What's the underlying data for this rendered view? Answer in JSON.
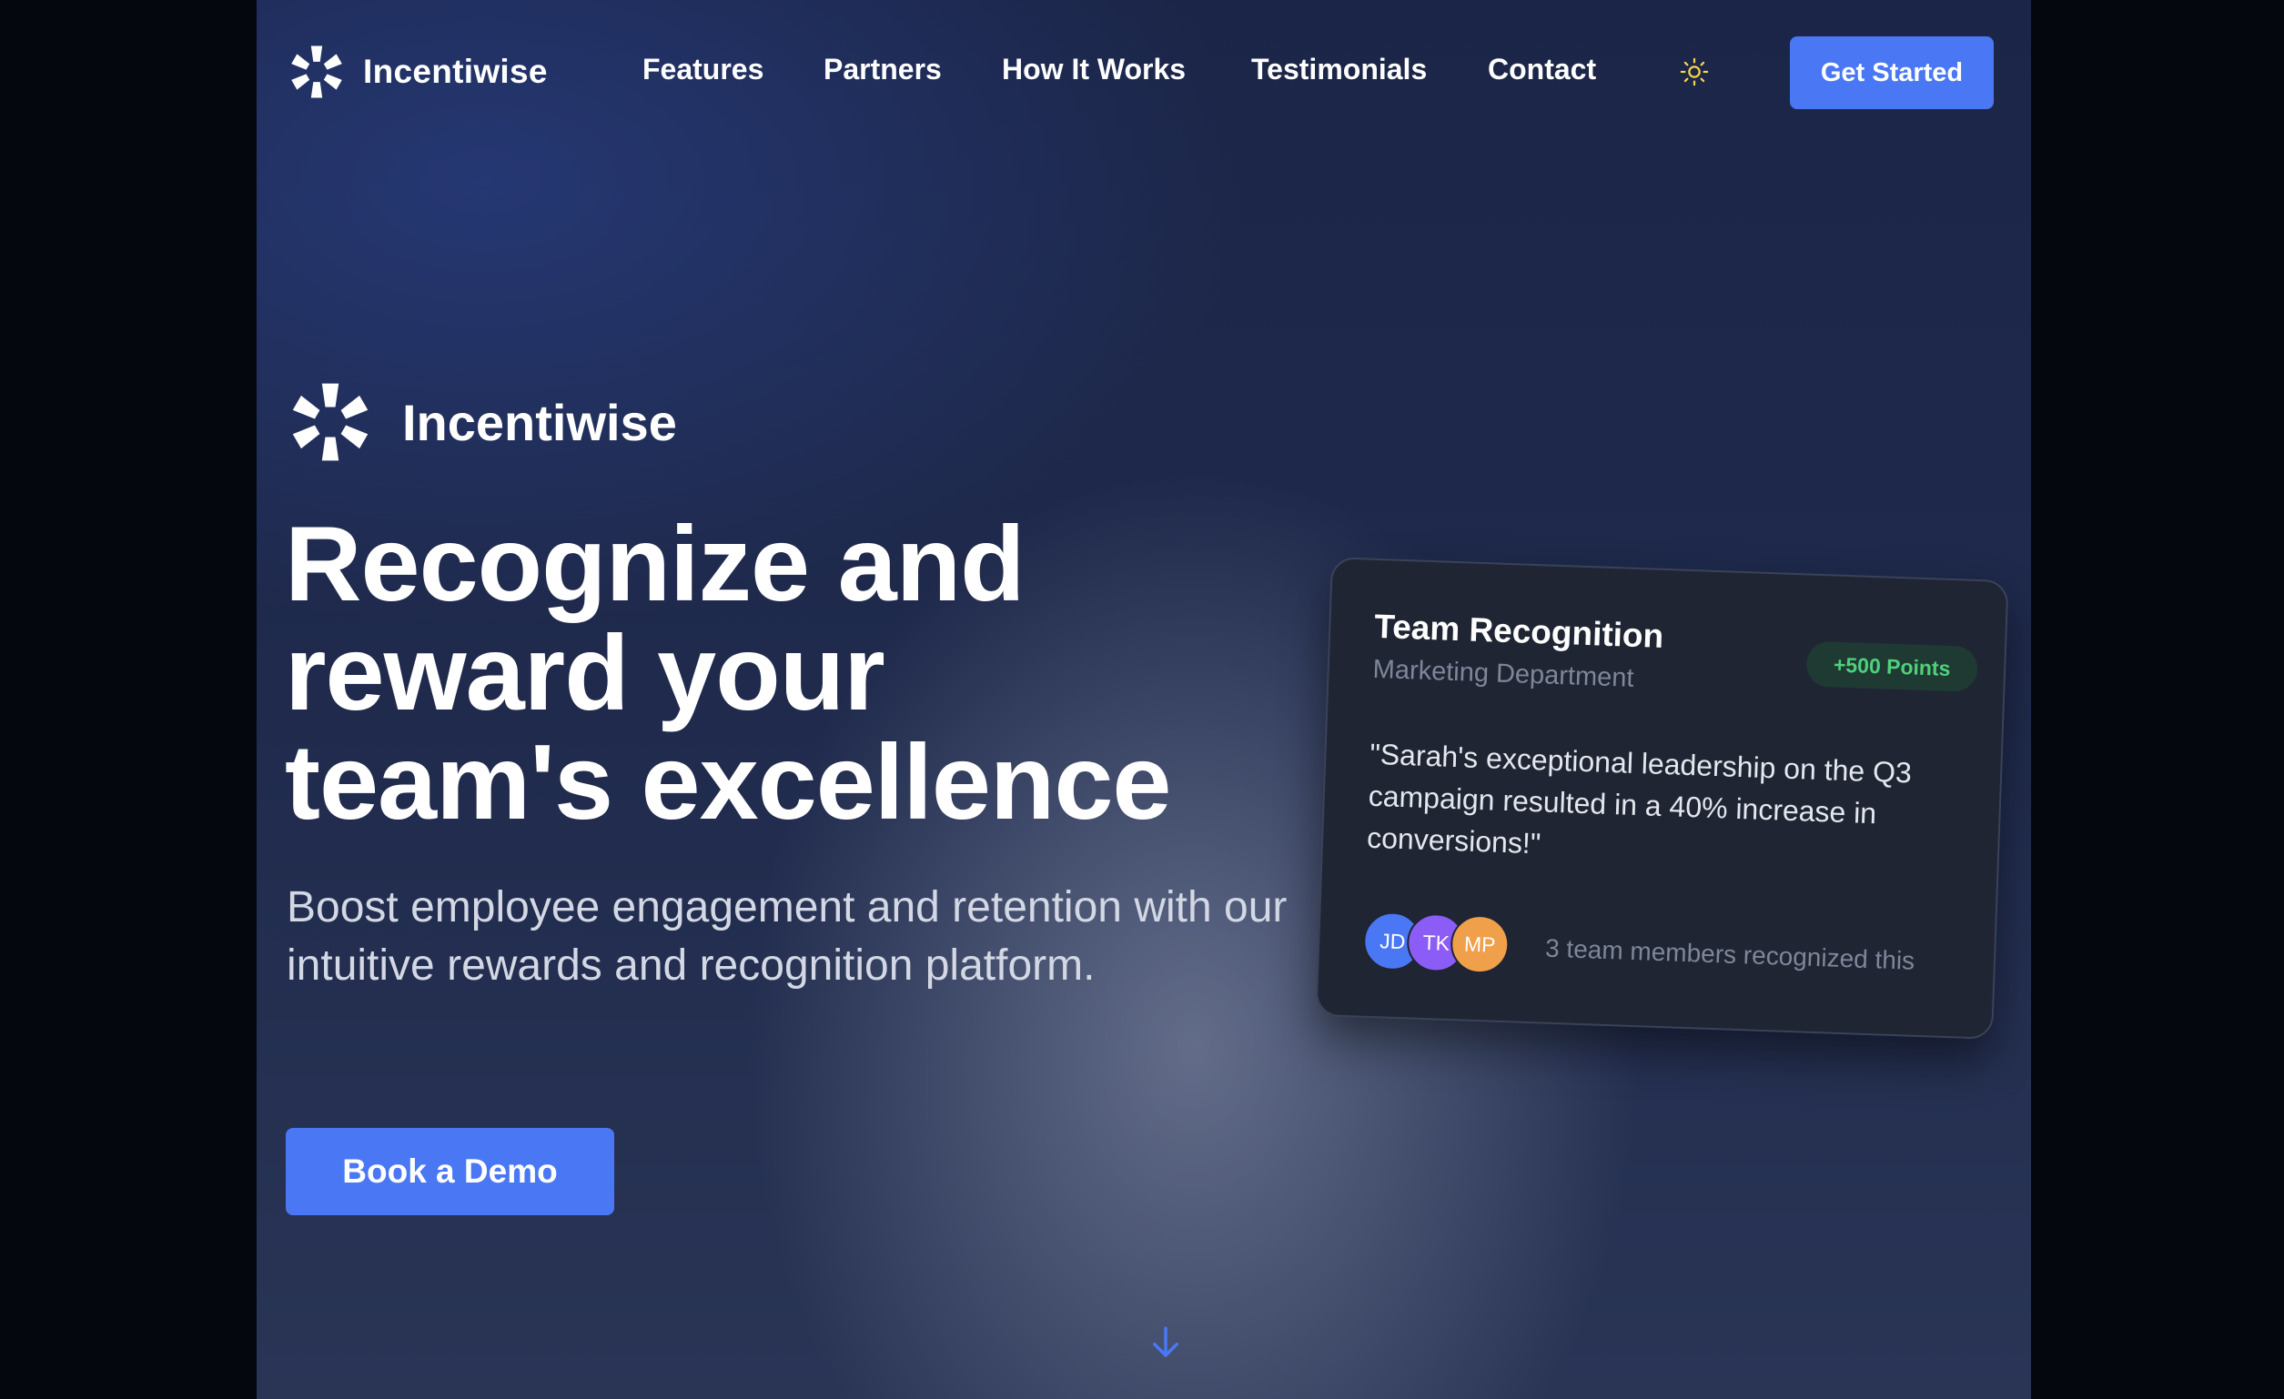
{
  "nav": {
    "brand": "Incentiwise",
    "links": [
      {
        "label": "Features"
      },
      {
        "label": "Partners"
      },
      {
        "label": "How It Works"
      },
      {
        "label": "Testimonials"
      },
      {
        "label": "Contact"
      }
    ],
    "theme_icon": "sun-icon",
    "cta_label": "Get Started"
  },
  "hero": {
    "brand": "Incentiwise",
    "headline_lines": [
      "Recognize and",
      "reward your",
      "team's excellence"
    ],
    "subtext": "Boost employee engagement and retention with our intuitive rewards and recognition platform.",
    "cta_label": "Book a Demo",
    "scroll_icon": "arrow-down-icon"
  },
  "card": {
    "title": "Team Recognition",
    "department": "Marketing Department",
    "badge": "+500 Points",
    "quote": "\"Sarah's exceptional leadership on the Q3 campaign resulted in a 40% increase in conversions!\"",
    "avatars": [
      {
        "initials": "JD",
        "color": "#4a78f5"
      },
      {
        "initials": "TK",
        "color": "#8b5cf6"
      },
      {
        "initials": "MP",
        "color": "#f0a04b"
      }
    ],
    "meta": "3 team members recognized this"
  },
  "colors": {
    "accent": "#4a78f5",
    "badge_text": "#4fd07a",
    "background": "#1f2a4c"
  }
}
